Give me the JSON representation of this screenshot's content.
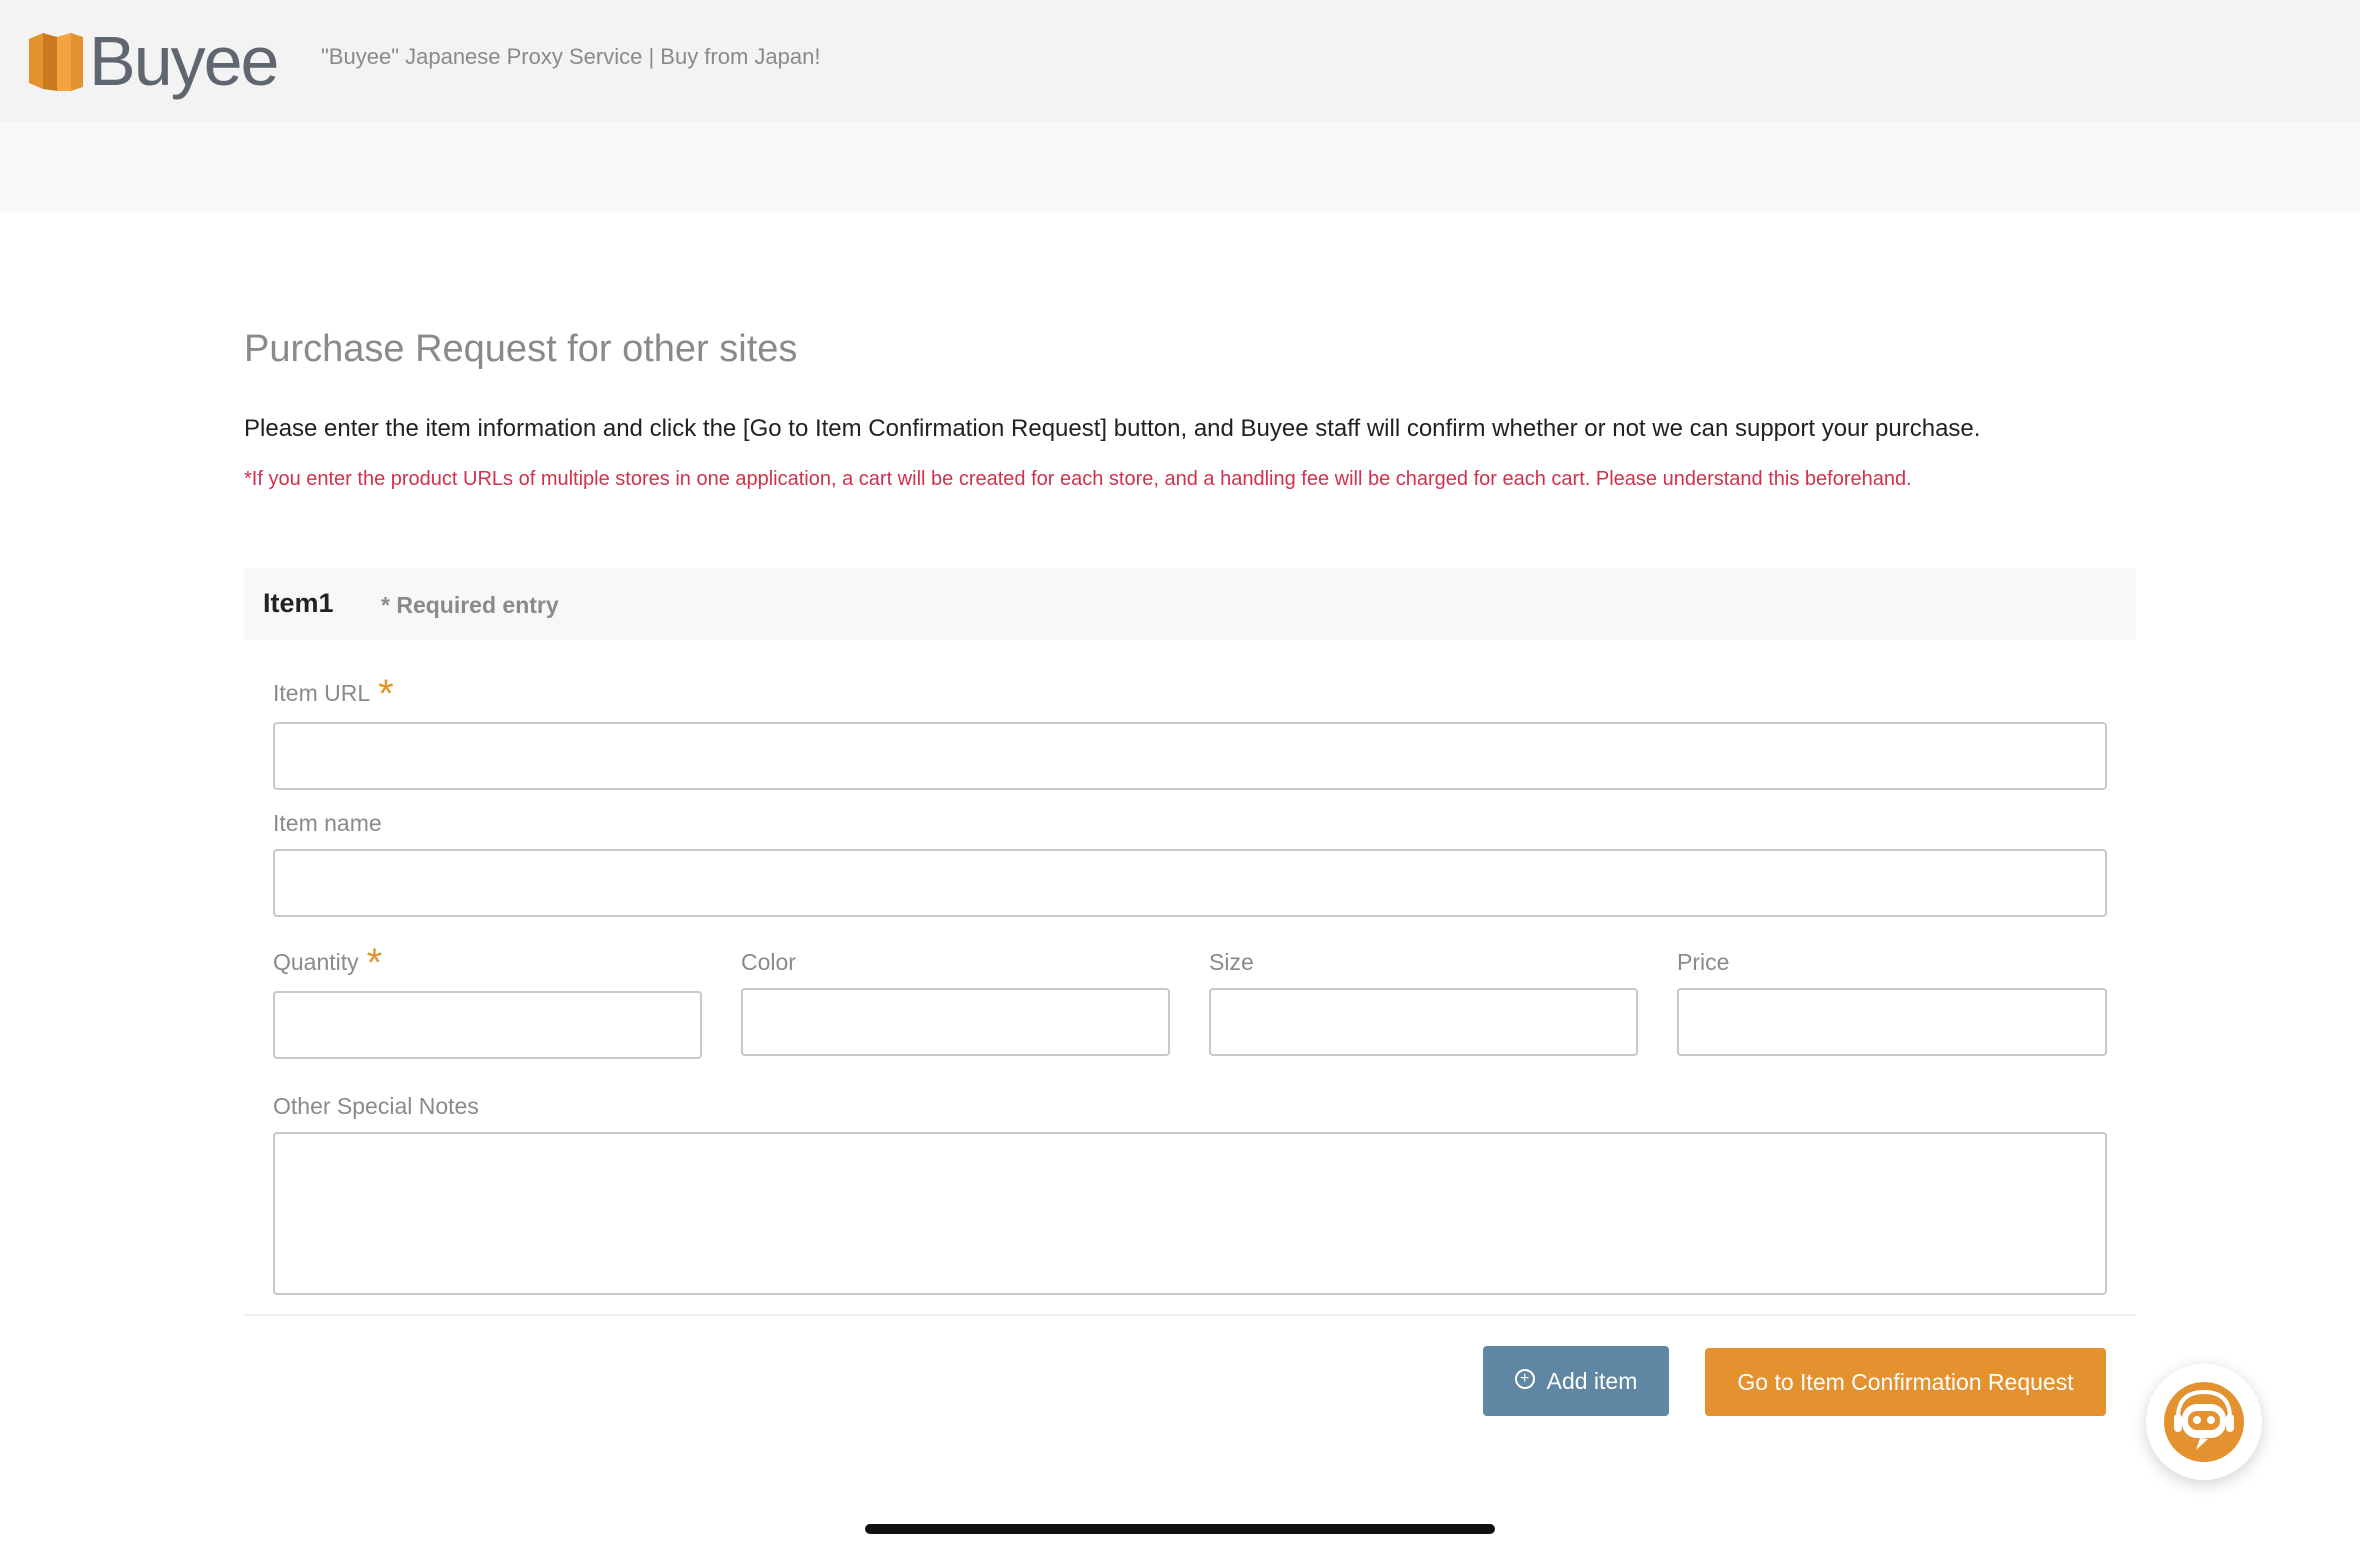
{
  "header": {
    "logo_text": "Buyee",
    "tagline": "\"Buyee\" Japanese Proxy Service | Buy from Japan!"
  },
  "page": {
    "title": "Purchase Request for other sites",
    "intro": "Please enter the item information and click the [Go to Item Confirmation Request] button, and Buyee staff will confirm whether or not we can support your purchase.",
    "warning": "*If you enter the product URLs of multiple stores in one application, a cart will be created for each store, and a handling fee will be charged for each cart. Please understand this beforehand."
  },
  "item": {
    "title": "Item1",
    "required_note": "* Required entry",
    "required_mark": "*",
    "fields": {
      "url_label": "Item URL",
      "url_value": "",
      "name_label": "Item name",
      "name_value": "",
      "quantity_label": "Quantity",
      "quantity_value": "",
      "color_label": "Color",
      "color_value": "",
      "size_label": "Size",
      "size_value": "",
      "price_label": "Price",
      "price_value": "",
      "notes_label": "Other Special Notes",
      "notes_value": ""
    }
  },
  "actions": {
    "add_item_label": "Add item",
    "confirm_label": "Go to Item Confirmation Request"
  },
  "colors": {
    "accent_orange": "#e3922f",
    "add_button_blue": "#5f87a3",
    "warning_red": "#d2314d"
  },
  "icons": {
    "logo": "buyee-box-logo",
    "add": "plus-circle-icon",
    "support": "robot-chat-icon"
  }
}
